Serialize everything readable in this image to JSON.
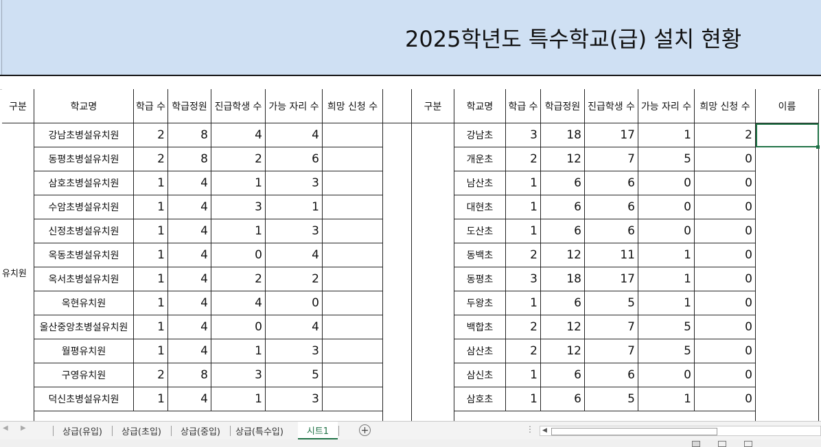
{
  "title": "2025학년도 특수학교(급) 설치 현황",
  "left_table": {
    "headers": [
      "구분",
      "학교명",
      "학급 수",
      "학급정원",
      "진급학생 수",
      "가능 자리 수",
      "희망 신청 수"
    ],
    "group_label": "유치원",
    "rows": [
      {
        "name": "강남초병설유치원",
        "classes": "2",
        "capacity": "8",
        "promoted": "4",
        "available": "4",
        "applied": ""
      },
      {
        "name": "동평초병설유치원",
        "classes": "2",
        "capacity": "8",
        "promoted": "2",
        "available": "6",
        "applied": ""
      },
      {
        "name": "삼호초병설유치원",
        "classes": "1",
        "capacity": "4",
        "promoted": "1",
        "available": "3",
        "applied": ""
      },
      {
        "name": "수암초병설유치원",
        "classes": "1",
        "capacity": "4",
        "promoted": "3",
        "available": "1",
        "applied": ""
      },
      {
        "name": "신정초병설유치원",
        "classes": "1",
        "capacity": "4",
        "promoted": "1",
        "available": "3",
        "applied": ""
      },
      {
        "name": "옥동초병설유치원",
        "classes": "1",
        "capacity": "4",
        "promoted": "0",
        "available": "4",
        "applied": ""
      },
      {
        "name": "옥서초병설유치원",
        "classes": "1",
        "capacity": "4",
        "promoted": "2",
        "available": "2",
        "applied": ""
      },
      {
        "name": "옥현유치원",
        "classes": "1",
        "capacity": "4",
        "promoted": "4",
        "available": "0",
        "applied": ""
      },
      {
        "name": "울산중앙초병설유치원",
        "classes": "1",
        "capacity": "4",
        "promoted": "0",
        "available": "4",
        "applied": ""
      },
      {
        "name": "월평유치원",
        "classes": "1",
        "capacity": "4",
        "promoted": "1",
        "available": "3",
        "applied": ""
      },
      {
        "name": "구영유치원",
        "classes": "2",
        "capacity": "8",
        "promoted": "3",
        "available": "5",
        "applied": ""
      },
      {
        "name": "덕신초병설유치원",
        "classes": "1",
        "capacity": "4",
        "promoted": "1",
        "available": "3",
        "applied": ""
      }
    ]
  },
  "right_table": {
    "headers": [
      "구분",
      "학교명",
      "학급 수",
      "학급정원",
      "진급학생 수",
      "가능 자리 수",
      "희망 신청 수",
      "이름"
    ],
    "rows": [
      {
        "name": "강남초",
        "classes": "3",
        "capacity": "18",
        "promoted": "17",
        "available": "1",
        "applied": "2"
      },
      {
        "name": "개운초",
        "classes": "2",
        "capacity": "12",
        "promoted": "7",
        "available": "5",
        "applied": "0"
      },
      {
        "name": "남산초",
        "classes": "1",
        "capacity": "6",
        "promoted": "6",
        "available": "0",
        "applied": "0"
      },
      {
        "name": "대현초",
        "classes": "1",
        "capacity": "6",
        "promoted": "6",
        "available": "0",
        "applied": "0"
      },
      {
        "name": "도산초",
        "classes": "1",
        "capacity": "6",
        "promoted": "6",
        "available": "0",
        "applied": "0"
      },
      {
        "name": "동백초",
        "classes": "2",
        "capacity": "12",
        "promoted": "11",
        "available": "1",
        "applied": "0"
      },
      {
        "name": "동평초",
        "classes": "3",
        "capacity": "18",
        "promoted": "17",
        "available": "1",
        "applied": "0"
      },
      {
        "name": "두왕초",
        "classes": "1",
        "capacity": "6",
        "promoted": "5",
        "available": "1",
        "applied": "0"
      },
      {
        "name": "백합초",
        "classes": "2",
        "capacity": "12",
        "promoted": "7",
        "available": "5",
        "applied": "0"
      },
      {
        "name": "삼산초",
        "classes": "2",
        "capacity": "12",
        "promoted": "7",
        "available": "5",
        "applied": "0"
      },
      {
        "name": "삼신초",
        "classes": "1",
        "capacity": "6",
        "promoted": "6",
        "available": "0",
        "applied": "0"
      },
      {
        "name": "삼호초",
        "classes": "1",
        "capacity": "6",
        "promoted": "5",
        "available": "1",
        "applied": "0"
      }
    ]
  },
  "sheet_tabs": [
    "상급(유입)",
    "상급(초입)",
    "상급(중입)",
    "상급(특수입)",
    "시트1"
  ],
  "active_tab": "시트1",
  "icons": {
    "add_sheet": "plus-circle-icon",
    "prev_sheet": "chevron-left-icon",
    "next_sheet": "chevron-right-icon"
  },
  "colors": {
    "title_band": "#cfe0f3",
    "accent": "#1e7145"
  }
}
